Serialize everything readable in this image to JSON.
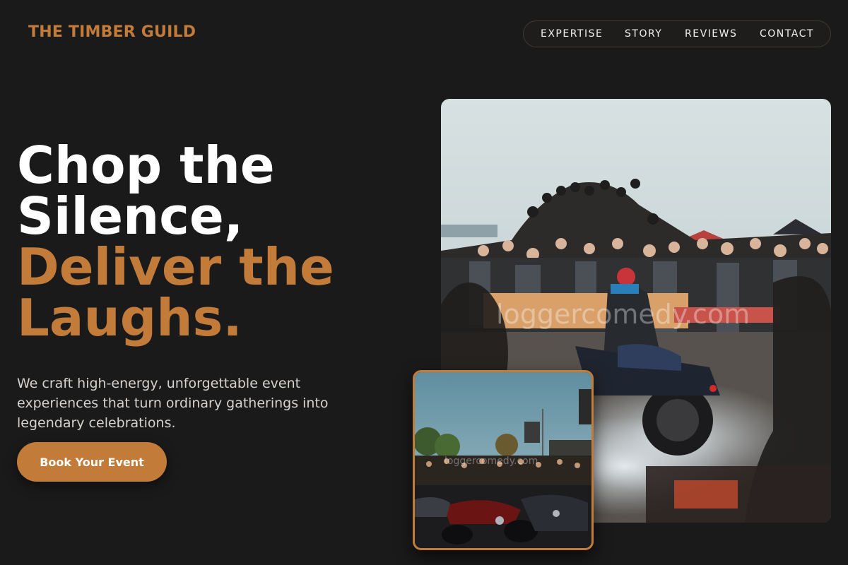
{
  "header": {
    "brand": "THE TIMBER GUILD",
    "nav": [
      {
        "label": "EXPERTISE"
      },
      {
        "label": "STORY"
      },
      {
        "label": "REVIEWS"
      },
      {
        "label": "CONTACT"
      }
    ]
  },
  "hero": {
    "headline_line1": "Chop the",
    "headline_line2": "Silence,",
    "headline_accent_line1": "Deliver the",
    "headline_accent_line2": "Laughs.",
    "subtext": "We craft high-energy, unforgettable event experiences that turn ordinary gatherings into legendary celebrations.",
    "cta_label": "Book Your Event"
  },
  "images": {
    "main_watermark": "loggercomedy.com",
    "inset_watermark": "loggercomedy.com"
  },
  "colors": {
    "background": "#1b1a1a",
    "accent": "#c27b38",
    "text": "#ffffff",
    "muted_text": "#d6d3cf"
  }
}
